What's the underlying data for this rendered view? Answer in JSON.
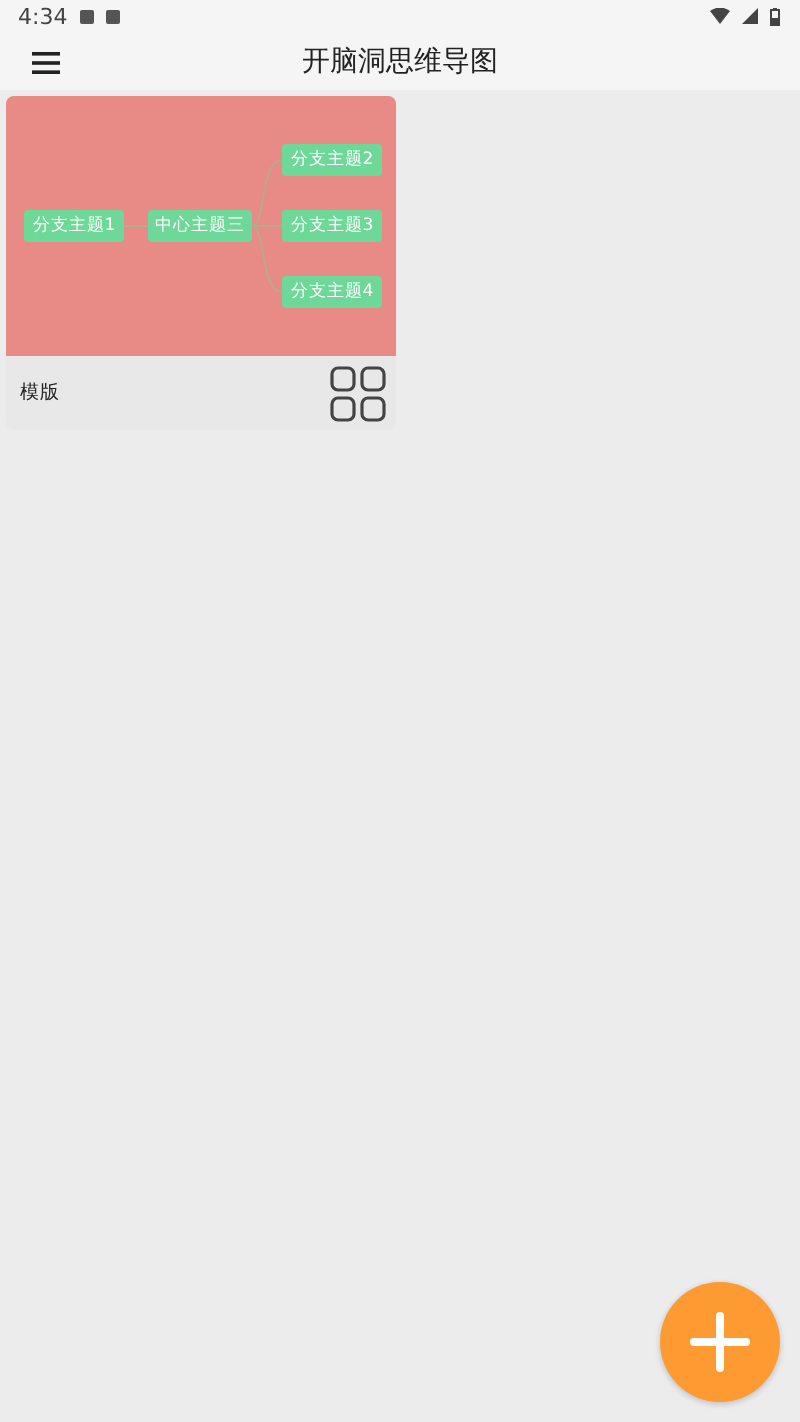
{
  "status_bar": {
    "time": "4:34"
  },
  "app_bar": {
    "title": "开脑洞思维导图"
  },
  "templates": [
    {
      "mind_map": {
        "center": "中心主题三",
        "left_branches": [
          {
            "label": "分支主题1"
          }
        ],
        "right_branches": [
          {
            "label": "分支主题2"
          },
          {
            "label": "分支主题3"
          },
          {
            "label": "分支主题4"
          }
        ]
      },
      "label": "模版"
    }
  ]
}
